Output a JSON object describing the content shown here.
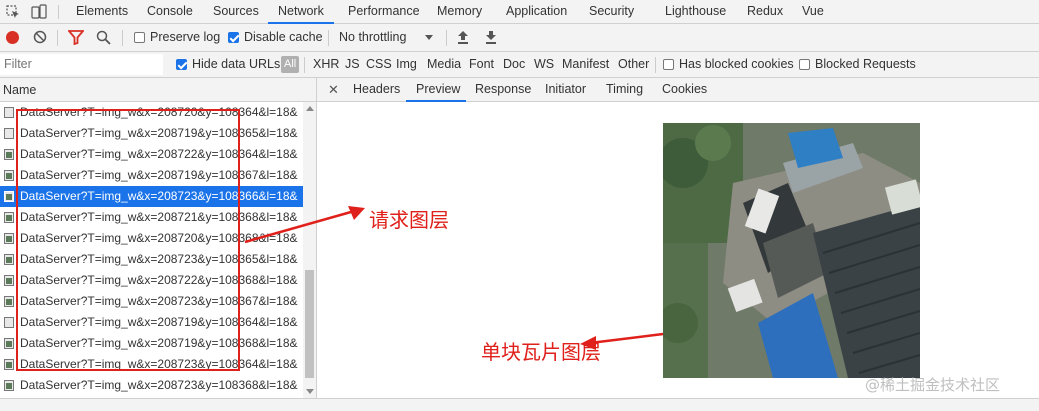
{
  "tabs": [
    {
      "label": "Elements"
    },
    {
      "label": "Console"
    },
    {
      "label": "Sources"
    },
    {
      "label": "Network"
    },
    {
      "label": "Performance"
    },
    {
      "label": "Memory"
    },
    {
      "label": "Application"
    },
    {
      "label": "Security"
    },
    {
      "label": "Lighthouse"
    },
    {
      "label": "Redux"
    },
    {
      "label": "Vue"
    }
  ],
  "toolbar": {
    "preserve_log": "Preserve log",
    "disable_cache": "Disable cache",
    "throttling": "No throttling"
  },
  "filter": {
    "placeholder": "Filter",
    "hide_data_urls": "Hide data URLs",
    "all": "All",
    "types": [
      "XHR",
      "JS",
      "CSS",
      "Img",
      "Media",
      "Font",
      "Doc",
      "WS",
      "Manifest",
      "Other"
    ],
    "has_blocked_cookies": "Has blocked cookies",
    "blocked_requests": "Blocked Requests"
  },
  "requests": {
    "header": "Name",
    "rows": [
      "DataServer?T=img_w&x=208720&y=108364&l=18&",
      "DataServer?T=img_w&x=208719&y=108365&l=18&",
      "DataServer?T=img_w&x=208722&y=108364&l=18&",
      "DataServer?T=img_w&x=208719&y=108367&l=18&",
      "DataServer?T=img_w&x=208723&y=108366&l=18&",
      "DataServer?T=img_w&x=208721&y=108368&l=18&",
      "DataServer?T=img_w&x=208720&y=108368&l=18&",
      "DataServer?T=img_w&x=208723&y=108365&l=18&",
      "DataServer?T=img_w&x=208722&y=108368&l=18&",
      "DataServer?T=img_w&x=208723&y=108367&l=18&",
      "DataServer?T=img_w&x=208719&y=108364&l=18&",
      "DataServer?T=img_w&x=208719&y=108368&l=18&",
      "DataServer?T=img_w&x=208723&y=108364&l=18&",
      "DataServer?T=img_w&x=208723&y=108368&l=18&"
    ],
    "selected_index": 4
  },
  "detail_tabs": [
    {
      "label": "Headers"
    },
    {
      "label": "Preview"
    },
    {
      "label": "Response"
    },
    {
      "label": "Initiator"
    },
    {
      "label": "Timing"
    },
    {
      "label": "Cookies"
    }
  ],
  "annotations": {
    "request_layer": "请求图层",
    "single_tile": "单块瓦片图层"
  },
  "watermark": "@稀土掘金技术社区",
  "colors": {
    "accent": "#1a73e8",
    "annotation": "#e0201a",
    "record": "#d93025"
  }
}
